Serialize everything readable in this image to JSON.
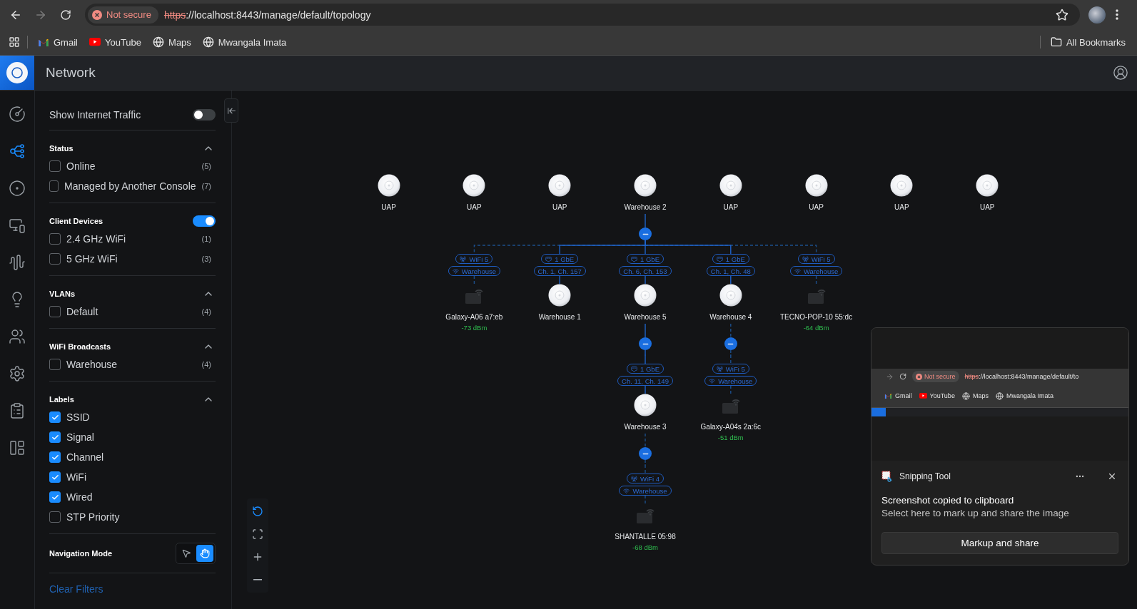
{
  "browser": {
    "nav": [
      {
        "kind": "back",
        "disabled": false
      },
      {
        "kind": "forward",
        "disabled": true
      },
      {
        "kind": "reload",
        "disabled": false
      }
    ],
    "security": "Not secure",
    "url_scheme": "https",
    "url_rest": "://localhost:8443/manage/default/topology",
    "bookmarks": [
      {
        "kind": "gmail",
        "label": "Gmail"
      },
      {
        "kind": "youtube",
        "label": "YouTube"
      },
      {
        "kind": "globe",
        "label": "Maps"
      },
      {
        "kind": "globe",
        "label": "Mwangala Imata"
      }
    ],
    "all_bookmarks": "All Bookmarks"
  },
  "app": {
    "title": "Network"
  },
  "rail": [
    {
      "kind": "dashboard",
      "selected": false
    },
    {
      "kind": "topology",
      "selected": true
    },
    {
      "kind": "devices",
      "selected": false
    },
    {
      "kind": "clients",
      "selected": false
    },
    {
      "kind": "insights",
      "selected": false
    },
    {
      "kind": "hotspot",
      "selected": false
    },
    {
      "kind": "users",
      "selected": false
    },
    {
      "kind": "settings",
      "selected": false
    },
    {
      "kind": "logs",
      "selected": false
    },
    {
      "kind": "floorplan",
      "selected": false
    }
  ],
  "filters": {
    "internet_traffic": {
      "label": "Show Internet Traffic",
      "on": false
    },
    "sections": [
      {
        "title": "Status",
        "kind": "collapsible",
        "expanded": true,
        "options": [
          {
            "label": "Online",
            "count": "(5)",
            "checked": false
          },
          {
            "label": "Managed by Another Console",
            "count": "(7)",
            "checked": false
          }
        ]
      },
      {
        "title": "Client Devices",
        "kind": "toggle",
        "on": true,
        "options": [
          {
            "label": "2.4 GHz WiFi",
            "count": "(1)",
            "checked": false
          },
          {
            "label": "5 GHz WiFi",
            "count": "(3)",
            "checked": false
          }
        ]
      },
      {
        "title": "VLANs",
        "kind": "collapsible",
        "expanded": true,
        "options": [
          {
            "label": "Default",
            "count": "(4)",
            "checked": false
          }
        ]
      },
      {
        "title": "WiFi Broadcasts",
        "kind": "collapsible",
        "expanded": true,
        "options": [
          {
            "label": "Warehouse",
            "count": "(4)",
            "checked": false
          }
        ]
      },
      {
        "title": "Labels",
        "kind": "collapsible",
        "expanded": true,
        "options": [
          {
            "label": "SSID",
            "checked": true
          },
          {
            "label": "Signal",
            "checked": true
          },
          {
            "label": "Channel",
            "checked": true
          },
          {
            "label": "WiFi",
            "checked": true
          },
          {
            "label": "Wired",
            "checked": true
          },
          {
            "label": "STP Priority",
            "checked": false
          }
        ]
      }
    ],
    "navigation_mode": {
      "label": "Navigation Mode",
      "modes": [
        {
          "kind": "pointer",
          "selected": false
        },
        {
          "kind": "hand",
          "selected": true
        }
      ]
    },
    "clear": "Clear Filters"
  },
  "topology": {
    "nodes": [
      {
        "kind": "ap",
        "name": "UAP"
      },
      {
        "kind": "ap",
        "name": "UAP"
      },
      {
        "kind": "ap",
        "name": "UAP"
      },
      {
        "kind": "ap",
        "name": "Warehouse 2",
        "expanded": true,
        "children": [
          {
            "kind": "client",
            "name": "Galaxy-A06 a7:eb",
            "signal": "-73 dBm",
            "wired": false,
            "badges": [
              {
                "kind": "standard",
                "text": "WiFi 5"
              },
              {
                "kind": "ssid",
                "text": "Warehouse"
              }
            ]
          },
          {
            "kind": "ap",
            "name": "Warehouse 1",
            "wired": true,
            "badges": [
              {
                "kind": "uplink",
                "text": "1 GbE"
              },
              {
                "kind": "channel",
                "text": "Ch. 1, Ch. 157"
              }
            ]
          },
          {
            "kind": "ap",
            "name": "Warehouse 5",
            "wired": true,
            "badges": [
              {
                "kind": "uplink",
                "text": "1 GbE"
              },
              {
                "kind": "channel",
                "text": "Ch. 6, Ch. 153"
              }
            ],
            "expanded": true,
            "children": [
              {
                "kind": "ap",
                "name": "Warehouse 3",
                "wired": true,
                "badges": [
                  {
                    "kind": "uplink",
                    "text": "1 GbE"
                  },
                  {
                    "kind": "channel",
                    "text": "Ch. 11, Ch. 149"
                  }
                ],
                "expanded": true,
                "children": [
                  {
                    "kind": "client",
                    "name": "SHANTALLE 05:98",
                    "signal": "-68 dBm",
                    "wired": false,
                    "badges": [
                      {
                        "kind": "standard",
                        "text": "WiFi 4"
                      },
                      {
                        "kind": "ssid",
                        "text": "Warehouse"
                      }
                    ]
                  }
                ]
              }
            ]
          },
          {
            "kind": "ap",
            "name": "Warehouse 4",
            "wired": true,
            "badges": [
              {
                "kind": "uplink",
                "text": "1 GbE"
              },
              {
                "kind": "channel",
                "text": "Ch. 1, Ch. 48"
              }
            ],
            "expanded": true,
            "children": [
              {
                "kind": "client",
                "name": "Galaxy-A04s 2a:6c",
                "signal": "-51 dBm",
                "wired": false,
                "badges": [
                  {
                    "kind": "standard",
                    "text": "WiFi 5"
                  },
                  {
                    "kind": "ssid",
                    "text": "Warehouse"
                  }
                ]
              }
            ]
          },
          {
            "kind": "client",
            "name": "TECNO-POP-10 55:dc",
            "signal": "-64 dBm",
            "wired": false,
            "badges": [
              {
                "kind": "standard",
                "text": "WiFi 5"
              },
              {
                "kind": "ssid",
                "text": "Warehouse"
              }
            ]
          }
        ]
      },
      {
        "kind": "ap",
        "name": "UAP"
      },
      {
        "kind": "ap",
        "name": "UAP"
      },
      {
        "kind": "ap",
        "name": "UAP"
      },
      {
        "kind": "ap",
        "name": "UAP"
      }
    ]
  },
  "canvas_tools": [
    {
      "kind": "reset",
      "selected": true
    },
    {
      "kind": "fit",
      "selected": false
    },
    {
      "kind": "zoom_in",
      "selected": false
    },
    {
      "kind": "zoom_out",
      "selected": false
    }
  ],
  "notification": {
    "preview": {
      "security": "Not secure",
      "url_scheme": "https",
      "url_rest": "://localhost:8443/manage/default/to",
      "bookmarks": [
        {
          "kind": "gmail",
          "label": "Gmail"
        },
        {
          "kind": "youtube",
          "label": "YouTube"
        },
        {
          "kind": "globe",
          "label": "Maps"
        },
        {
          "kind": "globe",
          "label": "Mwangala Imata"
        }
      ]
    },
    "app": "Snipping Tool",
    "title": "Screenshot copied to clipboard",
    "body": "Select here to mark up and share the image",
    "action": "Markup and share"
  }
}
